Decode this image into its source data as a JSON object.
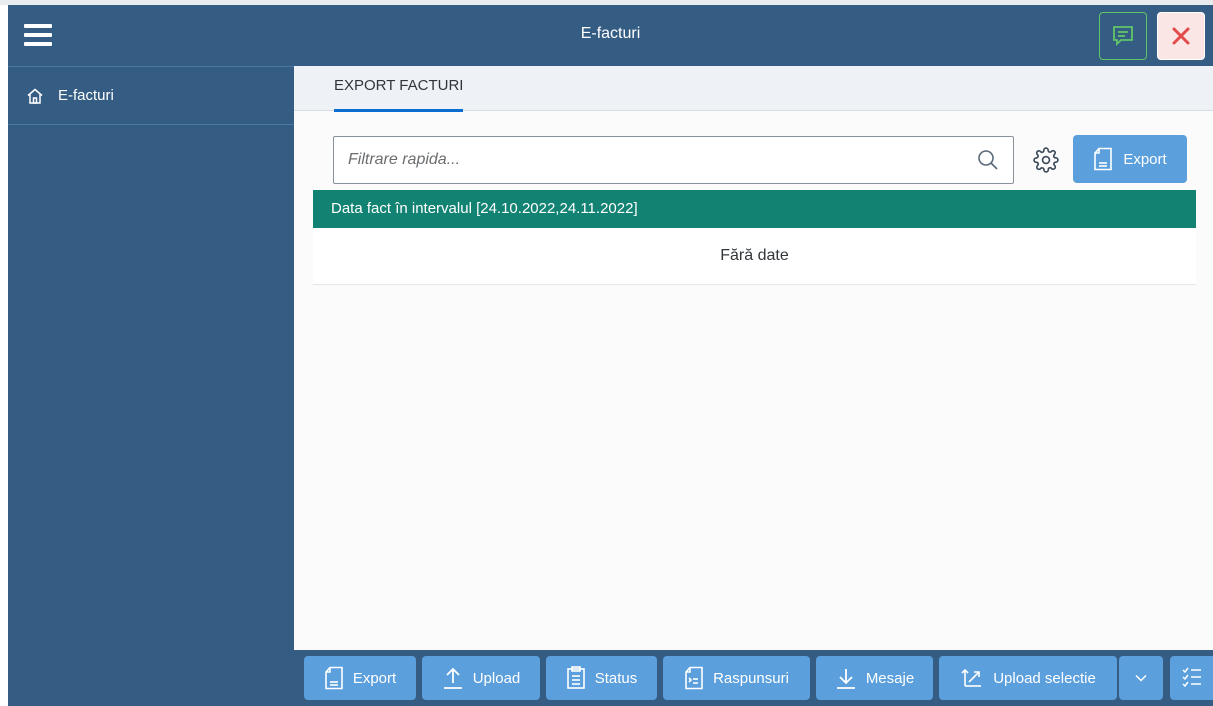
{
  "header": {
    "title": "E-facturi",
    "menu_icon": "hamburger-icon",
    "feedback_icon": "feedback-icon",
    "close_icon": "close-icon"
  },
  "sidebar": {
    "items": [
      {
        "label": "E-facturi",
        "icon": "home-icon"
      }
    ]
  },
  "tabs": [
    {
      "label": "EXPORT FACTURI",
      "active": true
    }
  ],
  "search": {
    "placeholder": "Filtrare rapida...",
    "value": ""
  },
  "toolbar": {
    "export_label": "Export"
  },
  "filter": {
    "text": "Data fact în intervalul [24.10.2022,24.11.2022]"
  },
  "table": {
    "empty_text": "Fără date"
  },
  "footer": {
    "buttons": [
      {
        "label": "Export",
        "icon": "document-icon"
      },
      {
        "label": "Upload",
        "icon": "upload-icon"
      },
      {
        "label": "Status",
        "icon": "clipboard-icon"
      },
      {
        "label": "Raspunsuri",
        "icon": "responses-icon"
      },
      {
        "label": "Mesaje",
        "icon": "download-icon"
      },
      {
        "label": "Upload selectie",
        "icon": "upload-selection-icon"
      }
    ]
  },
  "colors": {
    "shell": "#355d84",
    "accent_button": "#5b9fdc",
    "filter_bar": "#128273",
    "tab_underline": "#0a6ed1"
  }
}
